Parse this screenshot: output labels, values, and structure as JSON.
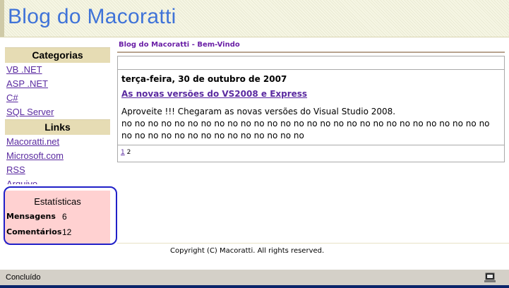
{
  "header": {
    "title": "Blog do Macoratti"
  },
  "sidebar": {
    "categorias_title": "Categorias",
    "categorias": [
      {
        "label": "VB .NET"
      },
      {
        "label": "ASP .NET"
      },
      {
        "label": "C#"
      },
      {
        "label": "SQL Server"
      }
    ],
    "links_title": "Links",
    "links": [
      {
        "label": "Macoratti.net"
      },
      {
        "label": "Microsoft.com"
      },
      {
        "label": "RSS"
      },
      {
        "label": "Arquivo"
      }
    ]
  },
  "stats": {
    "title": "Estatísticas",
    "mensagens_label": "Mensagens",
    "mensagens_value": "6",
    "comentarios_label": "Comentários",
    "comentarios_value": "12"
  },
  "main": {
    "breadcrumb": "Blog do Macoratti - Bem-Vindo",
    "post": {
      "date": "terça-feira, 30 de outubro de 2007",
      "title": "As novas versões do VS2008 e Express",
      "body_line1": "Aproveite !!! Chegaram as novas versões do Visual Studio 2008.",
      "body_line2": "no no no no no no no no no no no no no no no no no no no no no no no no no no no no",
      "body_line3": "no no no no no no no no no no no no no no"
    },
    "pager": {
      "page1": "1",
      "page2": "2"
    }
  },
  "footer": {
    "copyright": "Copyright (C) Macoratti. All rights reserved."
  },
  "status_bar": {
    "text": "Concluído"
  }
}
